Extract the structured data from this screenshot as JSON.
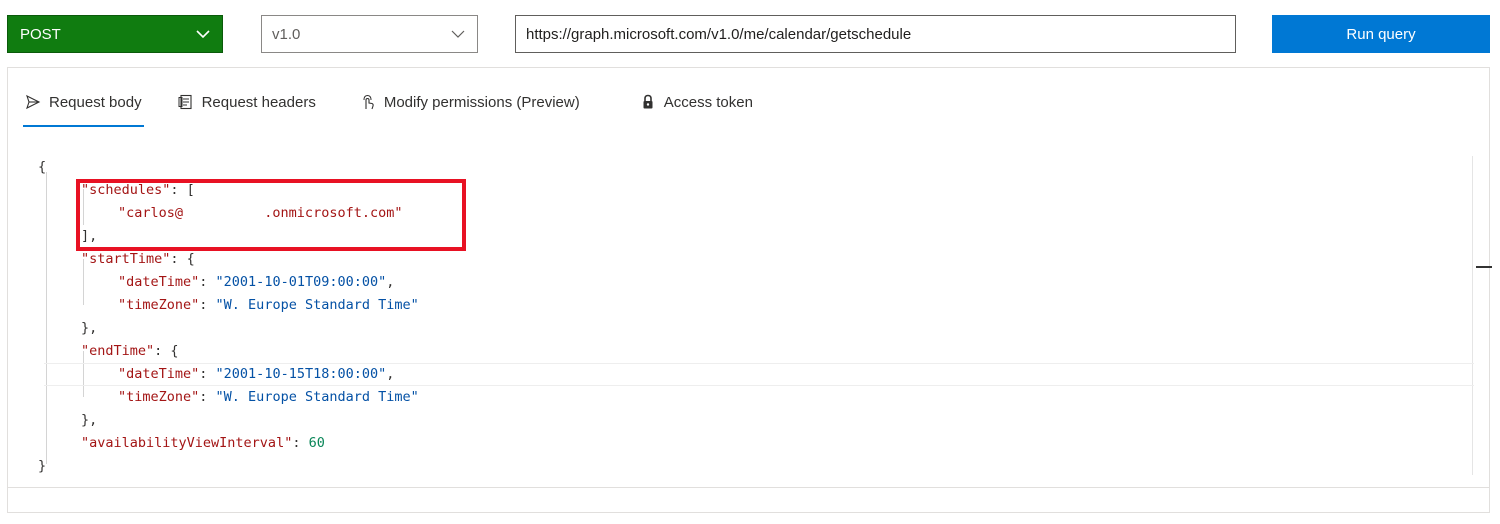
{
  "toolbar": {
    "method": "POST",
    "version": "v1.0",
    "url": "https://graph.microsoft.com/v1.0/me/calendar/getschedule",
    "run_label": "Run query"
  },
  "tabs": [
    {
      "label": "Request body",
      "icon": "send-icon",
      "active": true
    },
    {
      "label": "Request headers",
      "icon": "document-icon",
      "active": false
    },
    {
      "label": "Modify permissions (Preview)",
      "icon": "touch-icon",
      "active": false
    },
    {
      "label": "Access token",
      "icon": "lock-icon",
      "active": false
    }
  ],
  "body": {
    "open_brace": "{",
    "schedules_key": "\"schedules\"",
    "schedules_open": ": [",
    "schedules_value": "\"carlos@          .onmicrosoft.com\"",
    "schedules_close": "],",
    "start_key": "\"startTime\"",
    "start_open": ": {",
    "start_date_key": "\"dateTime\"",
    "start_date_value": "\"2001-10-01T09:00:00\"",
    "start_tz_key": "\"timeZone\"",
    "start_tz_value": "\"W. Europe Standard Time\"",
    "start_close": "},",
    "end_key": "\"endTime\"",
    "end_open": ": {",
    "end_date_key": "\"dateTime\"",
    "end_date_value": "\"2001-10-15T18:00:00\"",
    "end_tz_key": "\"timeZone\"",
    "end_tz_value": "\"W. Europe Standard Time\"",
    "end_close": "},",
    "interval_key": "\"availabilityViewInterval\"",
    "interval_value": "60",
    "close_brace": "}"
  },
  "colors": {
    "method_bg": "#107c10",
    "run_bg": "#0078d4",
    "highlight_border": "#e81123",
    "json_key": "#a31515",
    "json_string": "#0451a5",
    "json_number": "#098658"
  }
}
